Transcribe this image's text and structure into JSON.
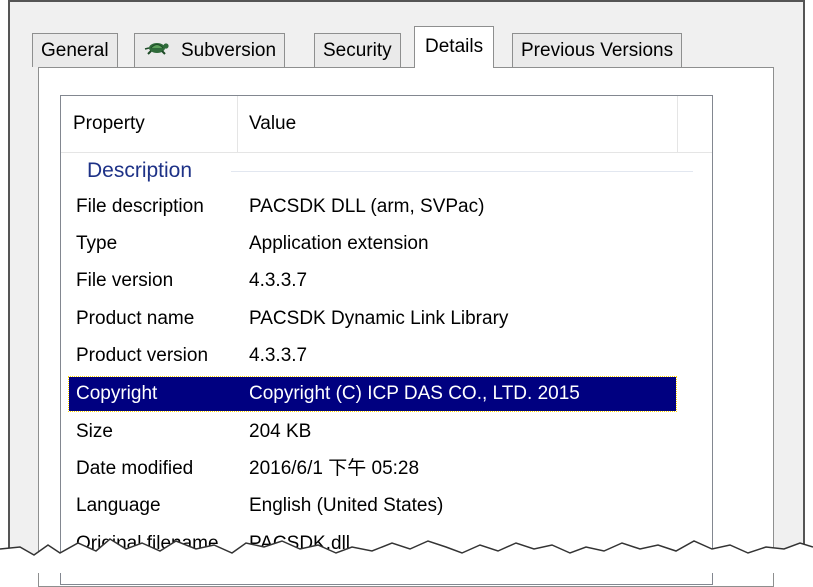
{
  "tabs": [
    {
      "label": "General",
      "active": false
    },
    {
      "label": "Subversion",
      "active": false,
      "icon": "turtle-icon"
    },
    {
      "label": "Security",
      "active": false
    },
    {
      "label": "Details",
      "active": true
    },
    {
      "label": "Previous Versions",
      "active": false
    }
  ],
  "columns": {
    "property": "Property",
    "value": "Value"
  },
  "group": {
    "label": "Description"
  },
  "rows": [
    {
      "property": "File description",
      "value": "PACSDK DLL (arm, SVPac)"
    },
    {
      "property": "Type",
      "value": "Application extension"
    },
    {
      "property": "File version",
      "value": "4.3.3.7"
    },
    {
      "property": "Product name",
      "value": "PACSDK Dynamic Link Library"
    },
    {
      "property": "Product version",
      "value": "4.3.3.7"
    },
    {
      "property": "Copyright",
      "value": "Copyright (C) ICP DAS CO., LTD. 2015",
      "selected": true
    },
    {
      "property": "Size",
      "value": "204 KB"
    },
    {
      "property": "Date modified",
      "value": "2016/6/1 下午 05:28"
    },
    {
      "property": "Language",
      "value": "English (United States)"
    },
    {
      "property": "Original filename",
      "value": "PACSDK.dll"
    }
  ],
  "colors": {
    "selection": "#000080",
    "group_header": "#1e3287"
  }
}
